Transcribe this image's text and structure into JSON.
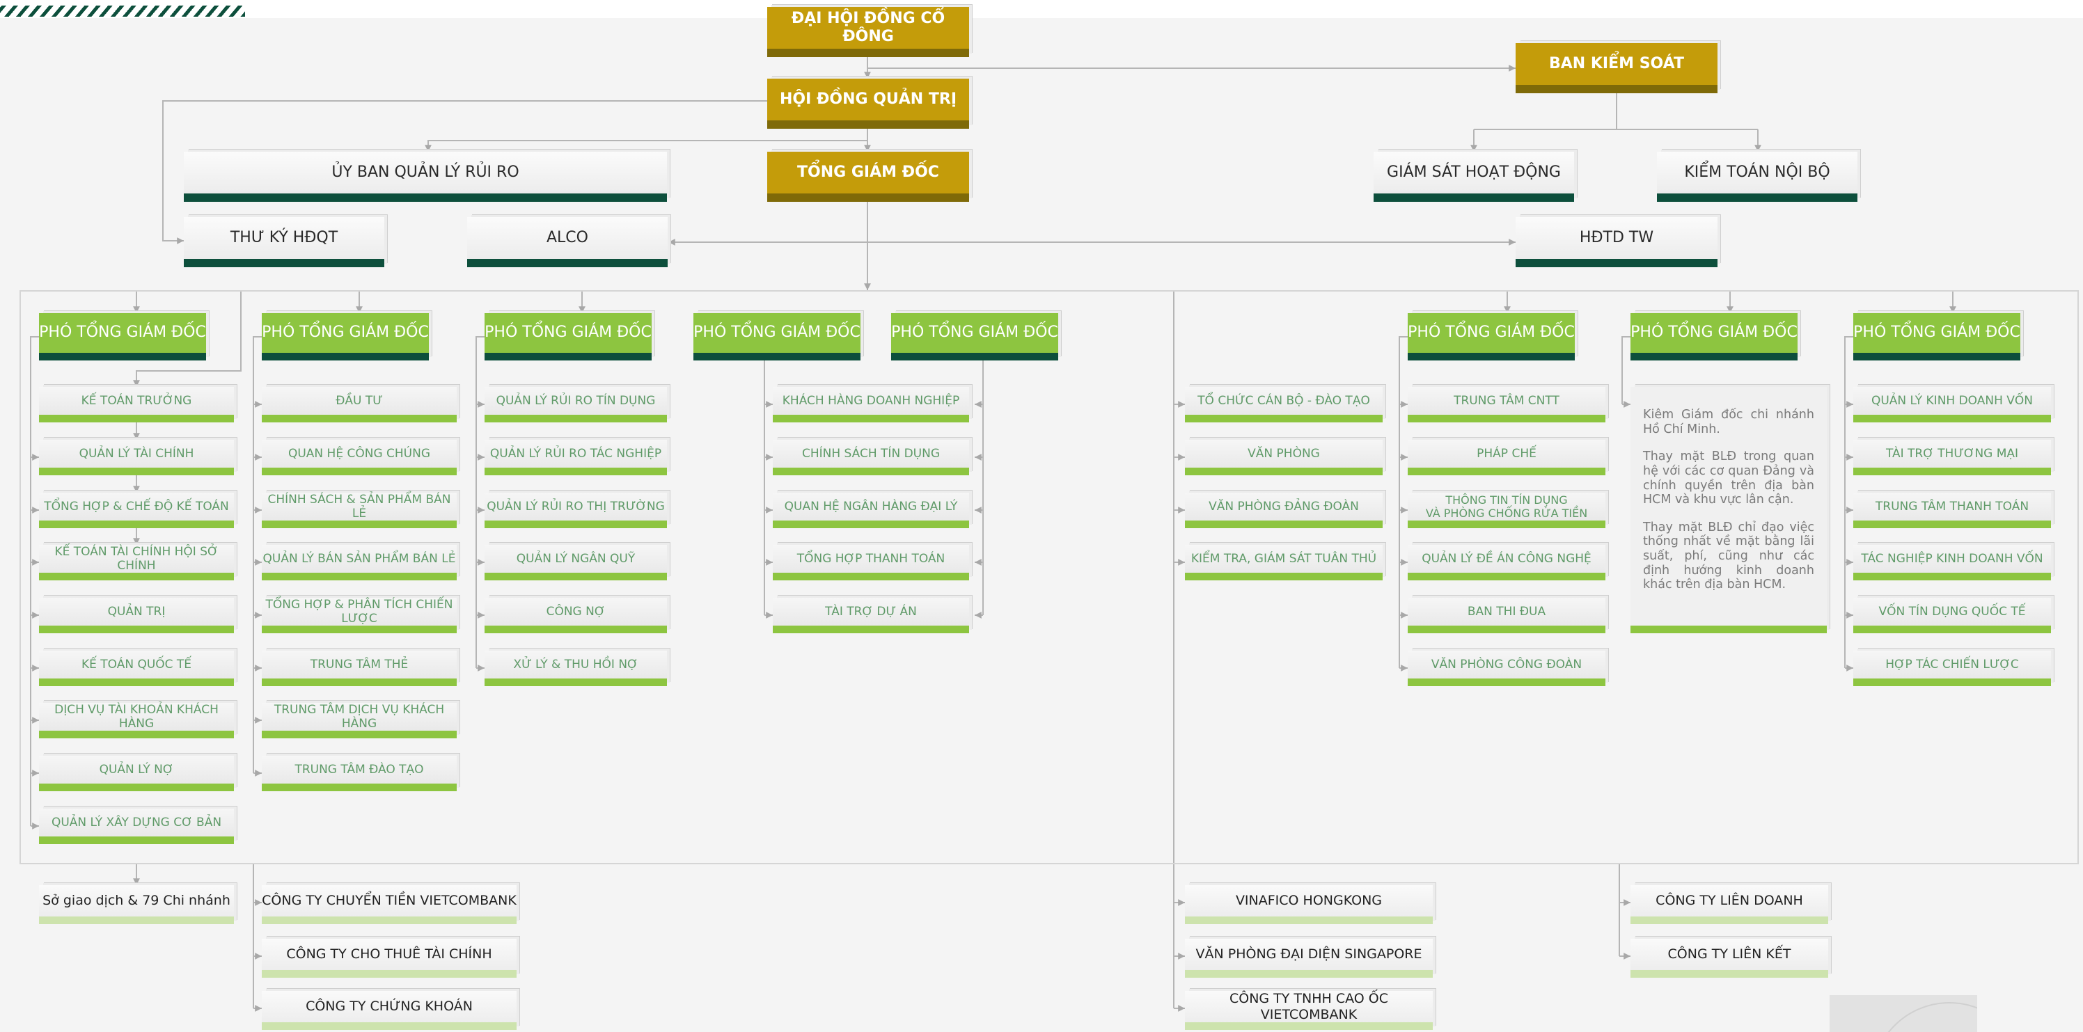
{
  "governance": {
    "dhdcd": "ĐẠI HỘI ĐỒNG CỔ ĐÔNG",
    "hdqt": "HỘI ĐỒNG QUẢN TRỊ",
    "bks": "BAN KIỂM SOÁT",
    "ubqlrr": "ỦY BAN QUẢN LÝ RỦI RO",
    "tgd": "TỔNG GIÁM ĐỐC",
    "gshd": "GIÁM SÁT HOẠT ĐỘNG",
    "ktnb": "KIỂM TOÁN NỘI BỘ",
    "tkhdqt": "THƯ KÝ HĐQT",
    "alco": "ALCO",
    "hdtd": "HĐTD TW"
  },
  "vp_label": "PHÓ TỔNG GIÁM ĐỐC",
  "columns": {
    "c1": [
      "KẾ TOÁN TRƯỞNG",
      "QUẢN LÝ TÀI CHÍNH",
      "TỔNG HỢP & CHẾ ĐỘ KẾ TOÁN",
      "KẾ TOÁN TÀI CHÍNH HỘI SỞ CHÍNH",
      "QUẢN TRỊ",
      "KẾ TOÁN QUỐC TẾ",
      "DỊCH VỤ TÀI KHOẢN KHÁCH HÀNG",
      "QUẢN LÝ NỢ",
      "QUẢN LÝ XÂY DỰNG CƠ BẢN"
    ],
    "c2": [
      "ĐẦU TƯ",
      "QUAN HỆ CÔNG CHÚNG",
      "CHÍNH SÁCH & SẢN PHẨM BÁN LẺ",
      "QUẢN LÝ BÁN SẢN PHẨM BÁN LẺ",
      "TỔNG HỢP & PHÂN TÍCH CHIẾN LƯỢC",
      "TRUNG TÂM THẺ",
      "TRUNG TÂM DỊCH VỤ KHÁCH HÀNG",
      "TRUNG TÂM ĐÀO TẠO"
    ],
    "c3": [
      "QUẢN LÝ RỦI RO TÍN DỤNG",
      "QUẢN LÝ RỦI RO TÁC NGHIỆP",
      "QUẢN LÝ RỦI RO THỊ TRƯỜNG",
      "QUẢN LÝ NGÂN QUỸ",
      "CÔNG NỢ",
      "XỬ LÝ & THU HỒI NỢ"
    ],
    "c45": [
      "KHÁCH HÀNG DOANH NGHIỆP",
      "CHÍNH SÁCH TÍN DỤNG",
      "QUAN HỆ NGÂN HÀNG ĐẠI LÝ",
      "TỔNG HỢP THANH TOÁN",
      "TÀI TRỢ DỰ ÁN"
    ],
    "c6": [
      "TỔ CHỨC CÁN BỘ - ĐÀO TẠO",
      "VĂN PHÒNG",
      "VĂN PHÒNG ĐẢNG ĐOÀN",
      "KIỂM TRA, GIÁM SÁT TUÂN THỦ"
    ],
    "c7": [
      "TRUNG TÂM CNTT",
      "PHÁP CHẾ",
      "THÔNG TIN TÍN DỤNG\nVÀ PHÒNG CHỐNG RỬA TIỀN",
      "QUẢN LÝ ĐỀ ÁN CÔNG NGHỆ",
      "BAN THI ĐUA",
      "VĂN PHÒNG CÔNG ĐOÀN"
    ],
    "c9": [
      "QUẢN LÝ KINH DOANH VỐN",
      "TÀI TRỢ THƯƠNG MẠI",
      "TRUNG TÂM THANH TOÁN",
      "TÁC NGHIỆP KINH DOANH VỐN",
      "VỐN TÍN DỤNG QUỐC TẾ",
      "HỢP TÁC CHIẾN LƯỢC"
    ]
  },
  "note": [
    "Kiêm Giám đốc chi nhánh Hồ Chí Minh.",
    "Thay mặt BLĐ trong quan hệ với các cơ quan Đảng và chính quyền trên địa bàn HCM và khu vực lân cận.",
    "Thay mặt BLĐ chỉ đạo việc thống nhất về mặt bằng lãi suất, phí, cũng như các định hướng kinh doanh khác trên địa bàn HCM."
  ],
  "subsidiaries": {
    "branch": "Sở giao dịch & 79 Chi nhánh",
    "g1": [
      "CÔNG TY CHUYỂN TIỀN VIETCOMBANK",
      "CÔNG TY CHO THUÊ TÀI CHÍNH",
      "CÔNG TY CHỨNG KHOÁN"
    ],
    "g2": [
      "VINAFICO HONGKONG",
      "VĂN PHÒNG ĐẠI DIỆN SINGAPORE",
      "CÔNG TY TNHH CAO ỐC VIETCOMBANK"
    ],
    "g3": [
      "CÔNG TY LIÊN DOANH",
      "CÔNG TY LIÊN KẾT"
    ]
  },
  "colors": {
    "gold": "#c49c0a",
    "dark_green": "#0d4f3c",
    "light_green": "#8dc540",
    "dept_text": "#5f9a68",
    "line": "#b5b5b5"
  }
}
